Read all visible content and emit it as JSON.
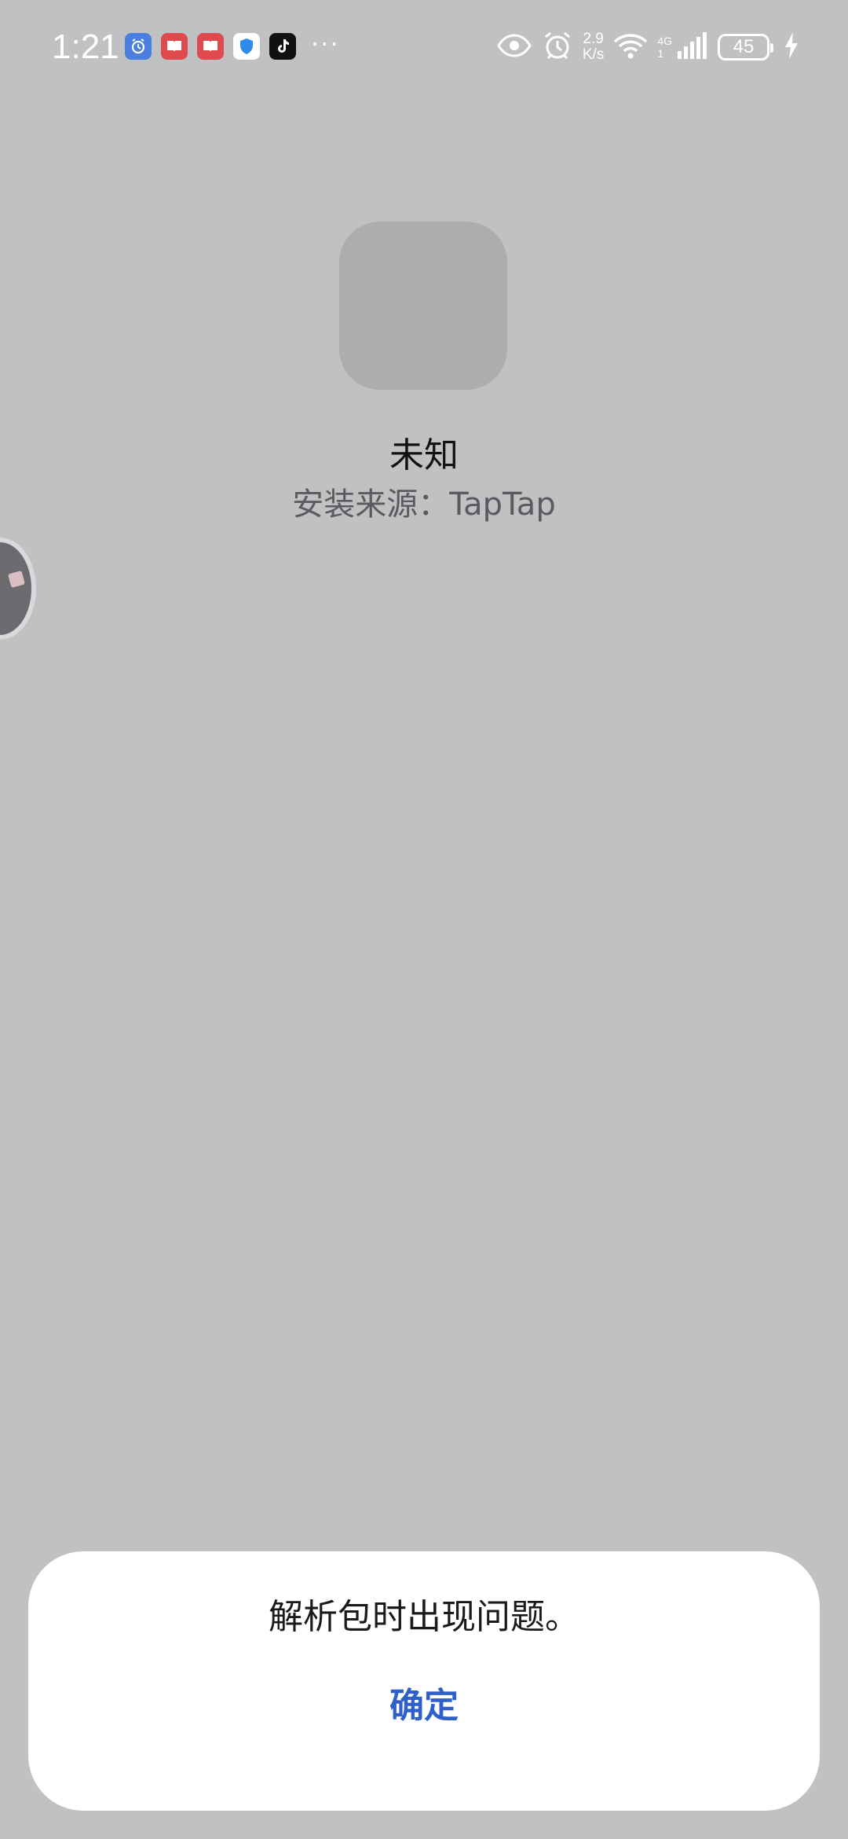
{
  "status_bar": {
    "time": "1:21",
    "more_indicator": "···",
    "net_speed_value": "2.9",
    "net_speed_unit": "K/s",
    "network_type": "4G",
    "network_sub": "1",
    "battery_level": "45",
    "notification_icons": [
      {
        "name": "clock-app-icon",
        "color": "#4a7fe0"
      },
      {
        "name": "book-app-icon",
        "color": "#e0494d"
      },
      {
        "name": "book-app-icon-2",
        "color": "#e0494d"
      },
      {
        "name": "shield-app-icon",
        "color": "#2f8ae8"
      },
      {
        "name": "tiktok-app-icon",
        "color": "#111111"
      }
    ]
  },
  "app": {
    "name": "未知",
    "install_source": "安装来源：TapTap"
  },
  "dialog": {
    "message": "解析包时出现问题。",
    "confirm_label": "确定"
  },
  "colors": {
    "background": "#c0c1c3",
    "accent": "#2f5fc8",
    "dialog_bg": "#ffffff"
  }
}
